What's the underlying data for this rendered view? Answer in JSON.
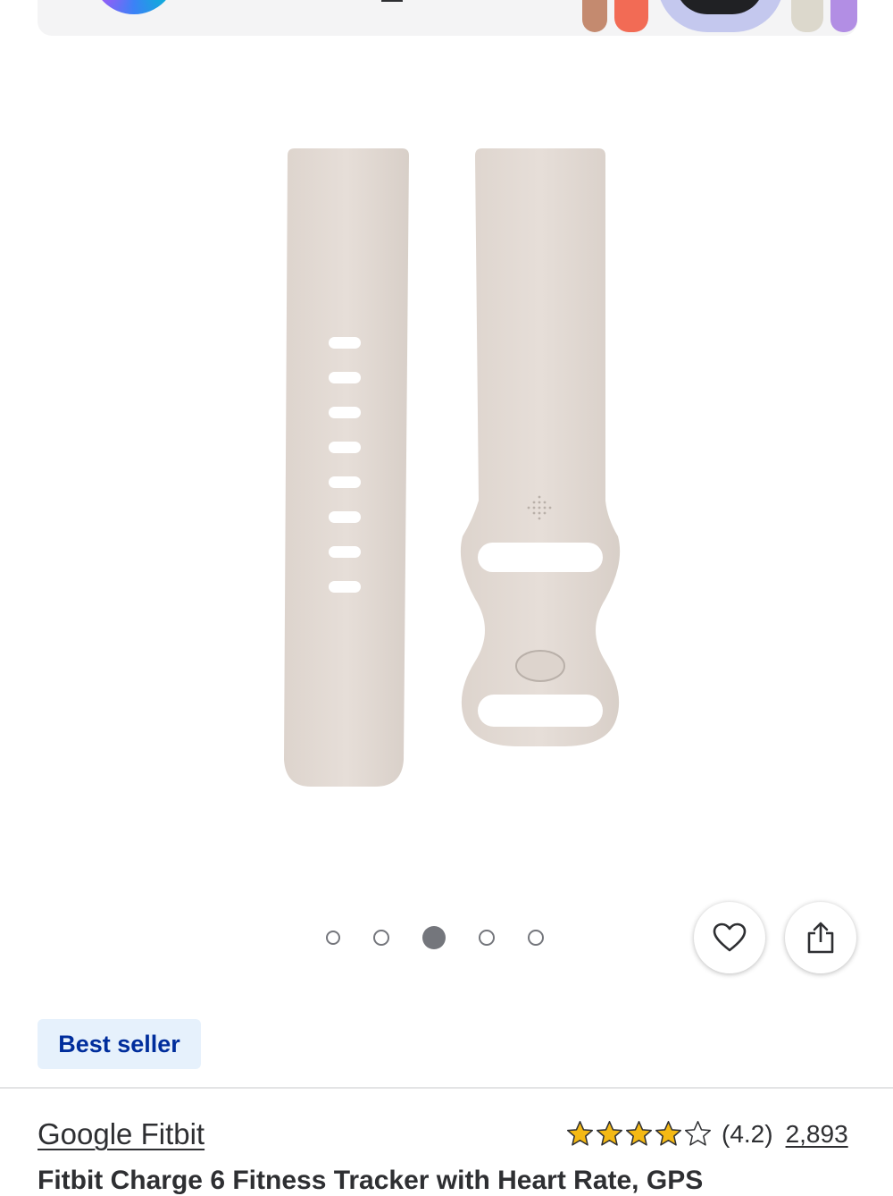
{
  "colors": {
    "badge_bg": "#e6f1fc",
    "badge_text": "#002d9c",
    "star": "#f4b914",
    "text": "#2e2f32"
  },
  "image_carousel": {
    "total_images": 5,
    "active_index": 3
  },
  "actions": {
    "favorite_icon": "heart-icon",
    "share_icon": "share-icon"
  },
  "badge": {
    "label": "Best seller"
  },
  "product": {
    "brand": "Google Fitbit",
    "title": "Fitbit Charge 6 Fitness Tracker with Heart Rate, GPS",
    "rating_value": "(4.2)",
    "rating": 4.2,
    "rating_max": 5,
    "review_count": "2,893"
  }
}
